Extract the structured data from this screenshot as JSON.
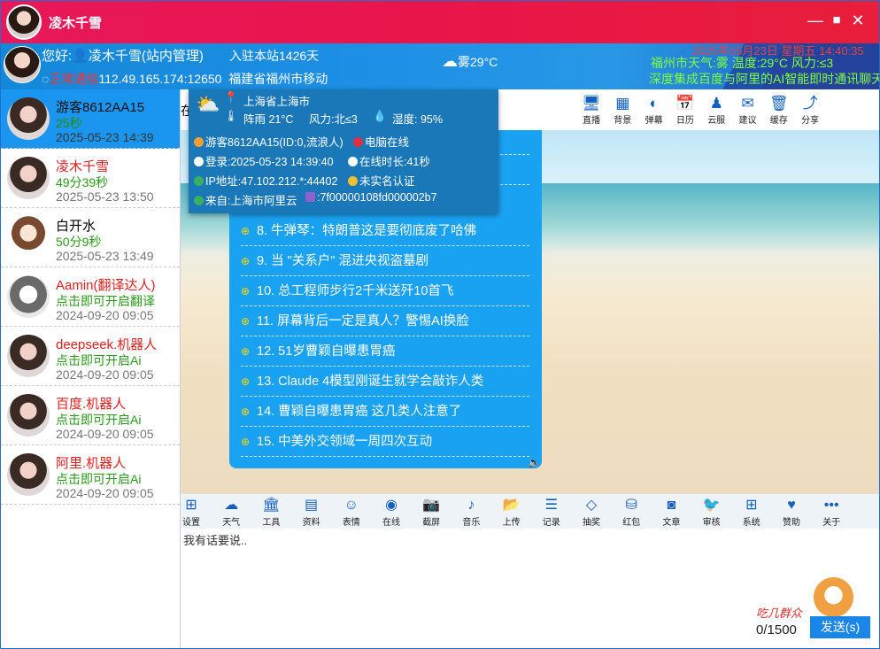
{
  "window": {
    "title": "凌木千雪"
  },
  "header": {
    "greeting": "您好:",
    "user": "凌木千雪(站内管理)",
    "station": "入驻本站1426天",
    "status": "正常通信",
    "address": "112.49.165.174:12650",
    "location": "福建省福州市移动",
    "weather": "雾29°C",
    "marquee_date": "2025年05月23日  星期五  14:40:35",
    "marquee_weather": "福州市天气:雾 温度:29°C 风力:≤3",
    "marquee_text": "深度集成百度与阿里的AI智能即时通讯聊天室"
  },
  "users": [
    {
      "name": "游客8612AA15",
      "status": "25秒",
      "time": "2025-05-23 14:39",
      "selected": true,
      "name_color": "#111"
    },
    {
      "name": "凌木千雪",
      "status": "49分39秒",
      "time": "2025-05-23 13:50",
      "name_color": "#e02020"
    },
    {
      "name": "白开水",
      "status": "50分9秒",
      "time": "2025-05-23 13:49",
      "name_color": "#111"
    },
    {
      "name": "Aamin(翻译达人)",
      "status": "点击即可开启翻译",
      "time": "2024-09-20 09:05",
      "name_color": "#e02020"
    },
    {
      "name": "deepseek.机器人",
      "status": "点击即可开启Ai",
      "time": "2024-09-20 09:05",
      "name_color": "#e02020"
    },
    {
      "name": "百度.机器人",
      "status": "点击即可开启Ai",
      "time": "2024-09-20 09:05",
      "name_color": "#e02020"
    },
    {
      "name": "阿里.机器人",
      "status": "点击即可开启Ai",
      "time": "2024-09-20 09:05",
      "name_color": "#e02020"
    }
  ],
  "top_tools": [
    "直播",
    "背景",
    "弹幕",
    "日历",
    "云服",
    "建议",
    "缓存",
    "分享"
  ],
  "top_tool_icons": [
    "monitor-icon",
    "grid-icon",
    "toggle-icon",
    "calendar-icon",
    "qq-icon",
    "mail-icon",
    "trash-icon",
    "share-icon"
  ],
  "popup": {
    "city": "上海省上海市",
    "weather": "阵雨 21°C",
    "wind": "风力:北≤3",
    "humidity": "湿度: 95%",
    "visitor": "游客8612AA15(ID:0,流浪人)",
    "device": "电脑在线",
    "login": "登录:2025-05-23 14:39:40",
    "online": "在线时长:41秒",
    "ip": "IP地址:47.102.212.*:44402",
    "auth": "未实名认证",
    "from": "来自:上海市阿里云",
    "id": ":7f00000108fd000002b7"
  },
  "partial_text": "在",
  "news": [
    "8. 牛弹琴：特朗普这是要彻底废了哈佛",
    "9. 当 \"关系户\" 混进央视盗墓剧",
    "10. 总工程师步行2千米送歼10首飞",
    "11. 屏幕背后一定是真人？警惕AI换脸",
    "12. 51岁曹颖自曝患胃癌",
    "13. Claude 4模型刚诞生就学会敲诈人类",
    "14. 曹颖自曝患胃癌 这几类人注意了",
    "15. 中美外交领域一周四次互动"
  ],
  "bottom_tools": [
    "设置",
    "天气",
    "工具",
    "资料",
    "表情",
    "在线",
    "截屏",
    "音乐",
    "上传",
    "记录",
    "抽奖",
    "红包",
    "文章",
    "审核",
    "系统",
    "赞助",
    "关于"
  ],
  "bottom_tool_icons": [
    "windows-icon",
    "cloud-icon",
    "bank-icon",
    "card-icon",
    "smile-icon",
    "user-circle-icon",
    "camera-icon",
    "music-icon",
    "folder-icon",
    "list-icon",
    "diamond-icon",
    "coins-icon",
    "rss-icon",
    "bird-icon",
    "windows-logo-icon",
    "heart-icon",
    "more-icon"
  ],
  "input": {
    "placeholder": "我有话要说..",
    "counter": "0/1500",
    "send": "发送(s)"
  },
  "logo": "吃几群众"
}
